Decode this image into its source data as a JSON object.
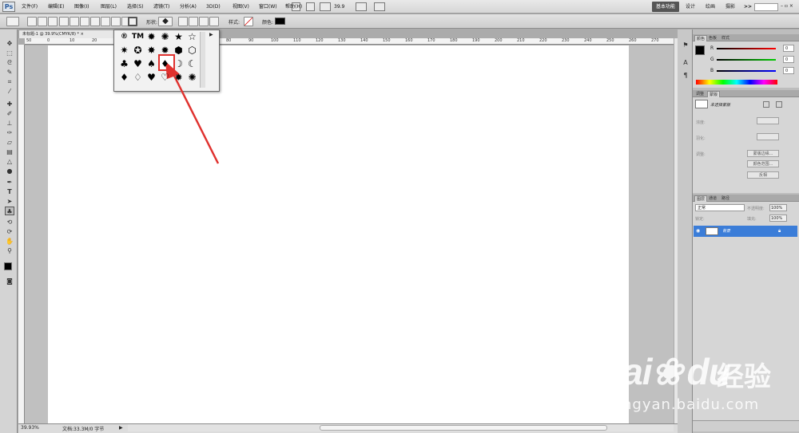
{
  "app": {
    "logo": "Ps"
  },
  "menu": [
    "文件(F)",
    "编辑(E)",
    "图像(I)",
    "图层(L)",
    "选择(S)",
    "滤镜(T)",
    "分析(A)",
    "3D(D)",
    "视图(V)",
    "窗口(W)",
    "帮助(H)"
  ],
  "menubar": {
    "zoom": "39.9",
    "workspaces": [
      "基本功能",
      "设计",
      "绘画",
      "摄影"
    ],
    "more": ">>",
    "search_placeholder": ""
  },
  "options": {
    "shape_label": "形状:",
    "style_label": "样式:",
    "color_label": "颜色:"
  },
  "document": {
    "tab_title": "未标题-1 @ 39.9%(CMYK/8) *",
    "close": "×",
    "ruler_top": [
      "50",
      "0",
      "10",
      "20",
      "30",
      "40",
      "50",
      "60",
      "70",
      "80",
      "90",
      "100",
      "110",
      "120",
      "130",
      "140",
      "150",
      "160",
      "170",
      "180",
      "190",
      "200",
      "210",
      "220",
      "230",
      "240",
      "250",
      "260",
      "270"
    ]
  },
  "status": {
    "zoom": "39.93%",
    "doc_info": "文档:33.3M/0 字节"
  },
  "shape_picker": {
    "rows": [
      [
        "®",
        "TM",
        "✹",
        "✺",
        "★",
        "☆"
      ],
      [
        "✷",
        "✪",
        "✸",
        "✹",
        "⬢",
        "⬡"
      ],
      [
        "♣",
        "♥",
        "♠",
        "♦",
        "☽",
        "☾"
      ],
      [
        "♦",
        "♢",
        "♥",
        "♡",
        "✹",
        "✺"
      ]
    ],
    "selected": "♦"
  },
  "color_panel": {
    "tabs": [
      "颜色",
      "色板",
      "样式"
    ],
    "channels": [
      {
        "label": "R",
        "value": "0"
      },
      {
        "label": "G",
        "value": "0"
      },
      {
        "label": "B",
        "value": "0"
      }
    ]
  },
  "adjust_panel": {
    "tabs": [
      "调整",
      "蒙版"
    ],
    "title": "未选择蒙版",
    "density_label": "浓度:",
    "feather_label": "羽化:",
    "refine_label": "调整:",
    "buttons": [
      "蒙版边缘...",
      "颜色范围...",
      "反相"
    ]
  },
  "layers_panel": {
    "tabs": [
      "图层",
      "通道",
      "路径"
    ],
    "blend": "正常",
    "opacity_label": "不透明度:",
    "opacity": "100%",
    "lock_label": "锁定:",
    "fill_label": "填充:",
    "fill": "100%",
    "layer_name": "背景"
  },
  "watermark": {
    "brand": "Bai",
    "brand2": "du",
    "cn": "经验",
    "url": "jingyan.baidu.com"
  },
  "colors": {
    "accent_red": "#e0322f",
    "selection_blue": "#3b7dd8"
  }
}
